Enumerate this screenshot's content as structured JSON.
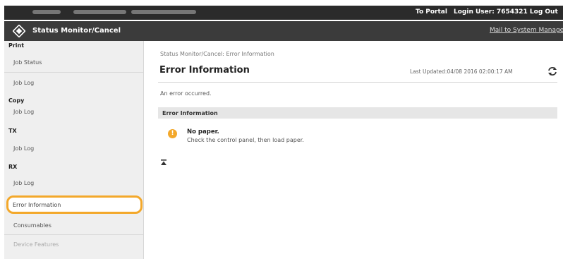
{
  "header": {
    "portal_link": "To Portal",
    "login_user": "Login User:  7654321  Log Out"
  },
  "titlebar": {
    "title": "Status Monitor/Cancel",
    "mail_link": "Mail to System Manager"
  },
  "sidebar": {
    "print_heading": "Print",
    "print_job_status": "Job Status",
    "print_job_log": "Job Log",
    "copy_heading": "Copy",
    "copy_job_log": "Job Log",
    "tx_heading": "TX",
    "tx_job_log": "Job Log",
    "rx_heading": "RX",
    "rx_job_log": "Job Log",
    "error_information": "Error Information",
    "consumables": "Consumables",
    "device_features": "Device Features"
  },
  "main": {
    "breadcrumb": "Status Monitor/Cancel: Error Information",
    "title": "Error Information",
    "last_updated": "Last Updated:04/08 2016 02:00:17 AM",
    "message": "An error occurred.",
    "section_title": "Error Information",
    "error_title": "No paper.",
    "error_detail": "Check the control panel, then load paper."
  },
  "colors": {
    "accent": "#f3a82b",
    "header_bg": "#2b2b2b",
    "titlebar_bg": "#3b3b3b"
  }
}
